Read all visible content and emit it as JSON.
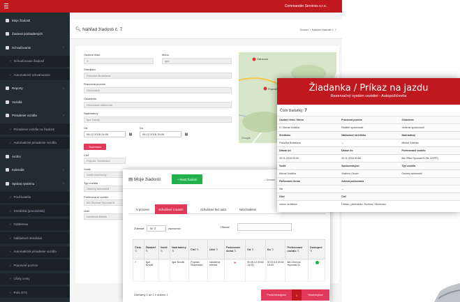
{
  "topbar": {
    "company": "Commander Services s.r.o."
  },
  "sidebar": {
    "items": [
      {
        "label": "Moje žiadosti",
        "sub": false,
        "arrow": false
      },
      {
        "label": "Žiadosti podriadených",
        "sub": false,
        "arrow": false
      },
      {
        "label": "Schvaľovanie",
        "sub": false,
        "arrow": true
      },
      {
        "label": "Schvaľovanie žiadostí",
        "sub": true,
        "arrow": false
      },
      {
        "label": "Automatické schvaľovanie",
        "sub": true,
        "arrow": false
      },
      {
        "label": "Reporty",
        "sub": false,
        "arrow": true
      },
      {
        "label": "Vozidlá",
        "sub": false,
        "arrow": false
      },
      {
        "label": "Priradenie vozidla",
        "sub": false,
        "arrow": true
      },
      {
        "label": "Priradenie vozidla na žiadosti",
        "sub": true,
        "arrow": false
      },
      {
        "label": "Automatické priradenie vozidla",
        "sub": true,
        "arrow": false
      },
      {
        "label": "Archív",
        "sub": false,
        "arrow": false
      },
      {
        "label": "Kalendár",
        "sub": false,
        "arrow": true
      },
      {
        "label": "Správa systému",
        "sub": false,
        "arrow": true
      },
      {
        "label": "Používatelia",
        "sub": true,
        "arrow": false
      },
      {
        "label": "Strediská (pracoviská)",
        "sub": true,
        "arrow": false
      },
      {
        "label": "Oddelenia",
        "sub": true,
        "arrow": false
      },
      {
        "label": "Nákladové strediská",
        "sub": true,
        "arrow": false
      },
      {
        "label": "Automatické priradenie vozidla",
        "sub": true,
        "arrow": false
      },
      {
        "label": "Pracovné pozície",
        "sub": true,
        "arrow": false
      },
      {
        "label": "Účely cesty",
        "sub": true,
        "arrow": false
      },
      {
        "label": "Role SYS",
        "sub": true,
        "arrow": false
      }
    ]
  },
  "header": {
    "title": "Náhľad žiadosti č. 7",
    "breadcrumb": "Domov > Náhľad žiadosti č. 7"
  },
  "form": {
    "osobne_cislo_label": "Osobné číslo",
    "osobne_cislo": "1",
    "meno_label": "Meno",
    "meno": "Igor",
    "stredisko_label": "Stredisko",
    "stredisko": "Pobočka Bratislava",
    "pozicia_label": "Pracovná pozícia",
    "pozicia": "Obchodník",
    "oddelenie_label": "Oddelenie",
    "oddelenie": "Obchodné oddelenie",
    "nadriadeny_label": "Nadriadený",
    "nadriadeny": "Igor Novák",
    "od_label": "Od",
    "od": "05.12.2018 14:00",
    "do_label": "Do",
    "do": "06.12.2018 15:00",
    "tag": "Tuzemsko",
    "ciel_label": "Cieľ",
    "ciel": "Poprad, Slovensko",
    "vodic_label": "Vodič",
    "vodic": "Vodič navrhnutý",
    "typ_label": "Typ vozidla",
    "typ": "Osobný automobil",
    "pref_label": "Preferované vozidlo",
    "pref": "BA Obchod Hyundai i3",
    "ucel_label": "Účel",
    "ucel": "návšteva klienta"
  },
  "map": {
    "city1": "Gánovce",
    "city2": "Poprad",
    "footer": "Google"
  },
  "order": {
    "title": "Žiadanka / Príkaz na jazdu",
    "subtitle": "Rezervačný systém vozidiel - Autopožičovňa",
    "number_label": "Číslo žiadanky:",
    "number": "7",
    "rows": [
      {
        "h": true,
        "c": [
          "Osobné číslo / Meno",
          "Pracovná pozícia",
          "Oddelenie"
        ]
      },
      {
        "h": false,
        "c": [
          "5 / Michal Vodička",
          "Riaditeľ spoločnosti",
          "Vedenie spoločnosti"
        ]
      },
      {
        "h": true,
        "c": [
          "Stredisko",
          "Nákladové stredisko",
          "Nadriadený"
        ]
      },
      {
        "h": false,
        "c": [
          "Pobočka Bratislava",
          "---",
          "Michal Vodička"
        ]
      },
      {
        "h": true,
        "c": [
          "Dátum od",
          "Dátum do",
          "Preferované vozidlo"
        ]
      },
      {
        "h": false,
        "c": [
          "30.11.2018 09:30",
          "30.11.2018 09:58",
          "BA Office Hyundai i3 (BL 222PP)"
        ]
      },
      {
        "h": true,
        "c": [
          "Vodič",
          "Spolucestujúci",
          "Typ vozidla"
        ]
      },
      {
        "h": false,
        "c": [
          "Michal Vodička",
          "Vladimír Osuch",
          "Osobný automobil"
        ]
      },
      {
        "h": true,
        "c": [
          "Parkovanie doma",
          "Adresa parkovania",
          ""
        ]
      },
      {
        "h": false,
        "c": [
          "Nie",
          "---",
          ""
        ]
      },
      {
        "h": true,
        "c": [
          "Účel",
          "Cieľ",
          ""
        ]
      },
      {
        "h": false,
        "c": [
          "odvoz na letisko",
          "Letisko, parkovisko, Ružinov, Slovensko",
          ""
        ]
      }
    ]
  },
  "requests": {
    "title": "Moje žiadosti",
    "new_button": "+ Nová žiadosť",
    "breadcrumb": "Domov",
    "tabs": [
      "V procese",
      "Schválené s autom",
      "Schválené bez auta",
      "Neschválené"
    ],
    "show_label": "Zobraziť",
    "show_value": "50",
    "records_label": "záznamov",
    "search_label": "Hľadať:",
    "columns": [
      "Číslo",
      "Žiadateľ",
      "Vodič",
      "Nadriadený",
      "Cieľ",
      "Účel",
      "Parkovanie doma",
      "Od",
      "Do",
      "Preferované vozidlo",
      "Dostupné"
    ],
    "row": [
      "7",
      "Igor Novák",
      "",
      "Igor Novák",
      "Poprad, Slovensko",
      "návšteva klienta",
      "✖",
      "St 05.12.2018 14:00",
      "St 05.12.2018 15:00",
      "BA Obchod Hyundai i3",
      ""
    ],
    "footer": "Záznamy 1 až 1 z celkom 1",
    "prev": "Predchádzajúca",
    "page": "1",
    "next": "Nasledujúca"
  },
  "colors": {
    "brand": "#c0181f",
    "accent": "#e0395c",
    "sidebar": "#222d32",
    "green": "#22b14c"
  }
}
